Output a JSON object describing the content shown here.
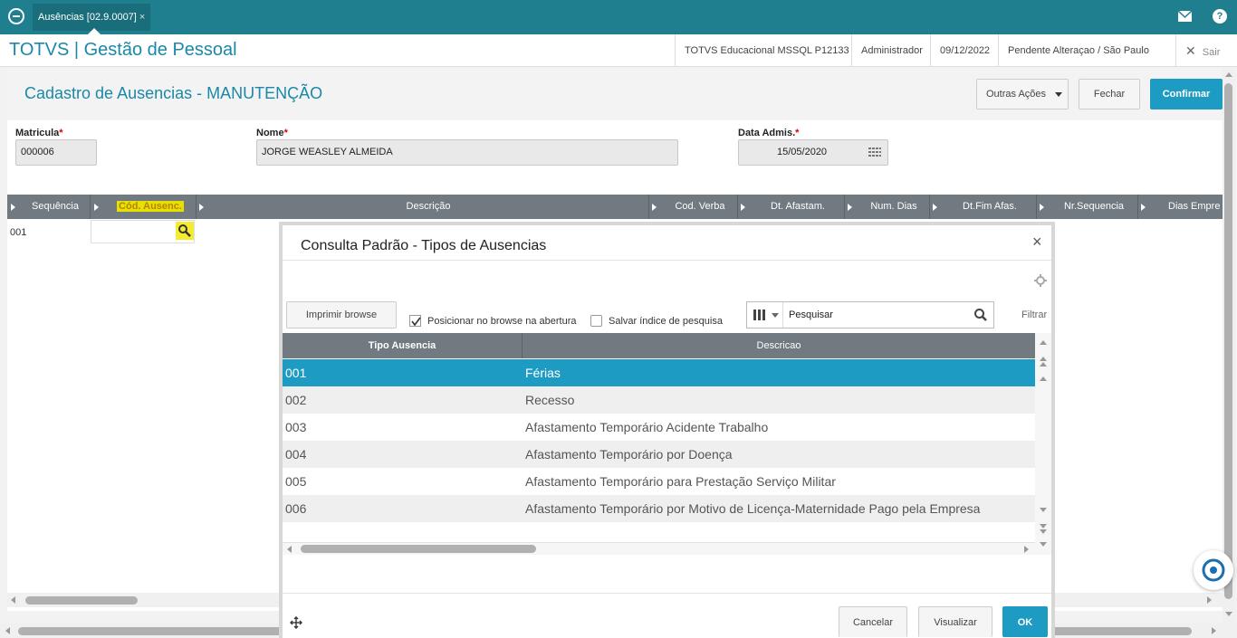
{
  "topbar": {
    "tab_label": "Ausências [02.9.0007]",
    "tab_close": "×"
  },
  "header": {
    "brand": "TOTVS | Gestão de Pessoal",
    "environment": "TOTVS Educacional MSSQL P12133",
    "user": "Administrador",
    "date": "09/12/2022",
    "branch": "Pendente Alteraçao / São Paulo",
    "exit_label": "Sair"
  },
  "form": {
    "title": "Cadastro de Ausencias - MANUTENÇÃO",
    "buttons": {
      "other_actions": "Outras Ações",
      "close": "Fechar",
      "confirm": "Confirmar"
    },
    "fields": {
      "matricula": {
        "label": "Matricula",
        "value": "000006"
      },
      "nome": {
        "label": "Nome",
        "value": "JORGE WEASLEY ALMEIDA"
      },
      "data_admis": {
        "label": "Data Admis.",
        "value": "15/05/2020"
      },
      "required_mark": "*"
    }
  },
  "grid": {
    "columns": [
      "Sequência",
      "Cód. Ausenc.",
      "Descrição",
      "Cod. Verba",
      "Dt. Afastam.",
      "Num. Dias",
      "Dt.Fim Afas.",
      "Nr.Sequencia",
      "Dias Empre"
    ],
    "rows": [
      {
        "sequencia": "001"
      }
    ]
  },
  "modal": {
    "title": "Consulta Padrão - Tipos de Ausencias",
    "close": "×",
    "print_button": "Imprimir browse",
    "check_position": {
      "label": "Posicionar no browse na abertura",
      "checked": true
    },
    "check_save_index": {
      "label": "Salvar índice de pesquisa",
      "checked": false
    },
    "search_placeholder": "Pesquisar",
    "filter_label": "Filtrar",
    "columns": [
      "Tipo Ausencia",
      "Descricao"
    ],
    "rows": [
      {
        "code": "001",
        "desc": "Férias",
        "selected": true
      },
      {
        "code": "002",
        "desc": "Recesso",
        "selected": false
      },
      {
        "code": "003",
        "desc": "Afastamento Temporário Acidente Trabalho",
        "selected": false
      },
      {
        "code": "004",
        "desc": "Afastamento Temporário por Doença",
        "selected": false
      },
      {
        "code": "005",
        "desc": "Afastamento Temporário para Prestação Serviço Militar",
        "selected": false
      },
      {
        "code": "006",
        "desc": "Afastamento Temporário por Motivo de Licença-Maternidade Pago pela Empresa",
        "selected": false
      }
    ],
    "buttons": {
      "cancel": "Cancelar",
      "view": "Visualizar",
      "ok": "OK"
    }
  },
  "colors": {
    "topbar": "#1f7f8f",
    "accent": "#1e9bc2",
    "selected_row": "#1e9bc2",
    "grid_header": "#707a80"
  },
  "icons": [
    "totvs-logo-icon",
    "mail-icon",
    "help-icon",
    "close-icon",
    "search-icon",
    "gear-icon",
    "calendar-icon",
    "move-icon",
    "chat-support-icon"
  ]
}
